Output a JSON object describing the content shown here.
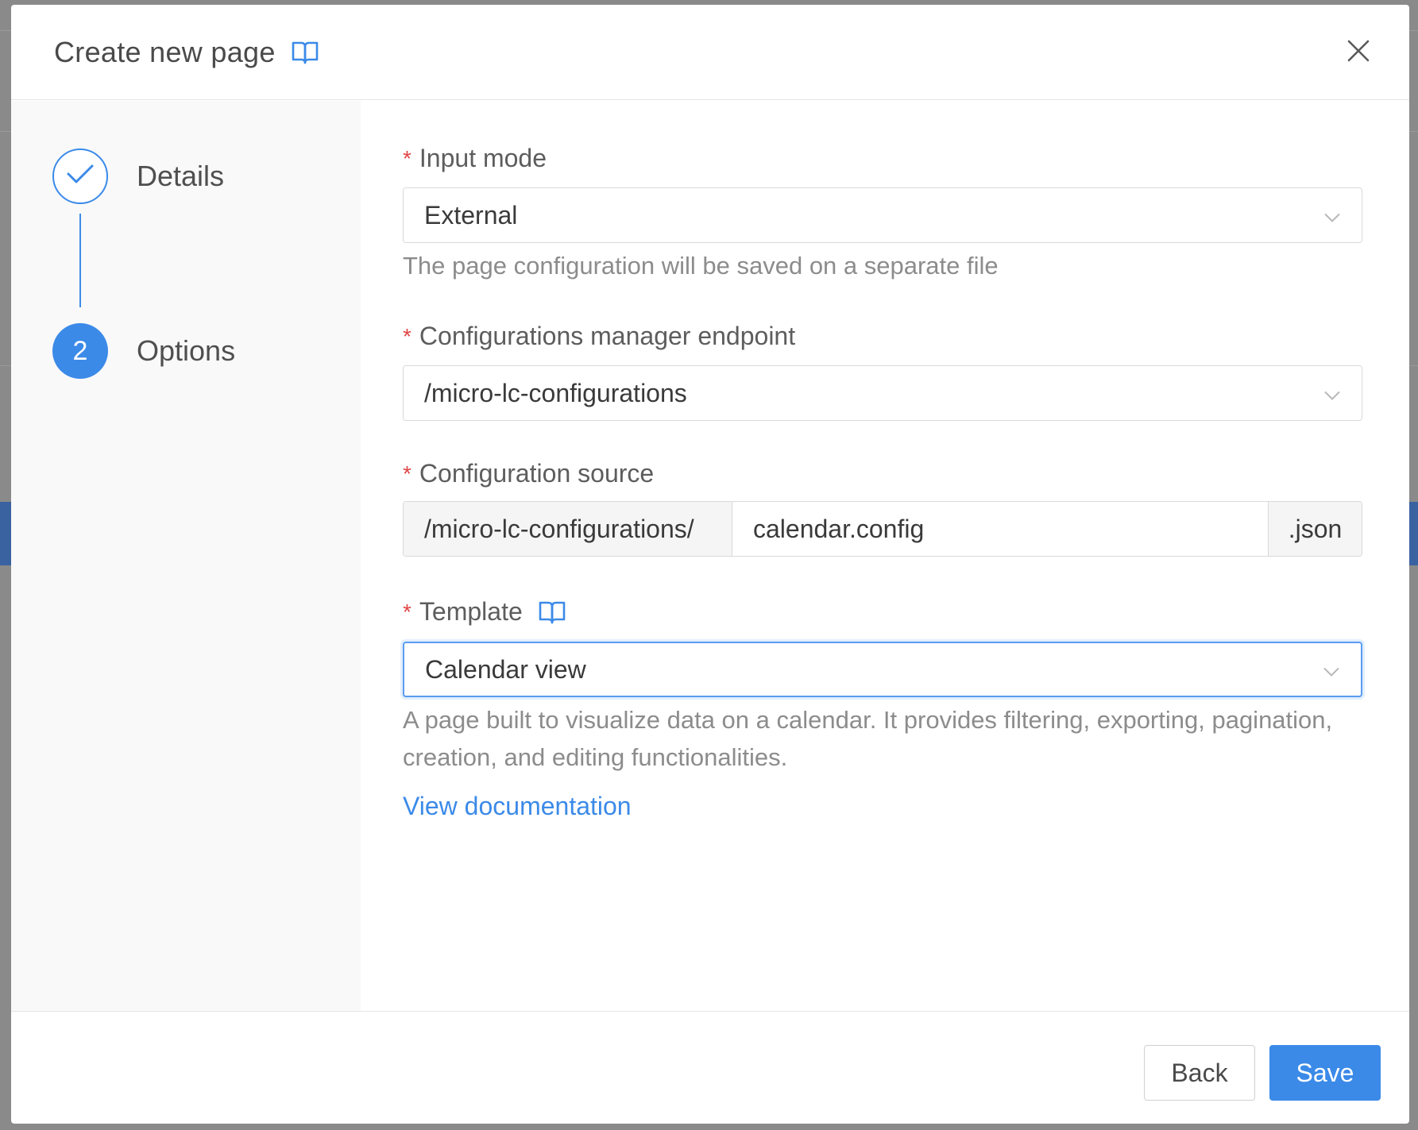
{
  "modal": {
    "title": "Create new page"
  },
  "steps": [
    {
      "label": "Details",
      "state": "done"
    },
    {
      "label": "Options",
      "number": "2",
      "state": "active"
    }
  ],
  "fields": {
    "input_mode": {
      "label": "Input mode",
      "value": "External",
      "help": "The page configuration will be saved on a separate file"
    },
    "endpoint": {
      "label": "Configurations manager endpoint",
      "value": "/micro-lc-configurations"
    },
    "source": {
      "label": "Configuration source",
      "prefix": "/micro-lc-configurations/",
      "value": "calendar.config",
      "suffix": ".json"
    },
    "template": {
      "label": "Template",
      "value": "Calendar view",
      "help": "A page built to visualize data on a calendar. It provides filtering, exporting, pagination, creation, and editing functionalities.",
      "doc_link": "View documentation"
    }
  },
  "required_marker": "*",
  "footer": {
    "back_label": "Back",
    "save_label": "Save"
  },
  "colors": {
    "accent": "#3b8ae8",
    "required": "#e04545"
  }
}
